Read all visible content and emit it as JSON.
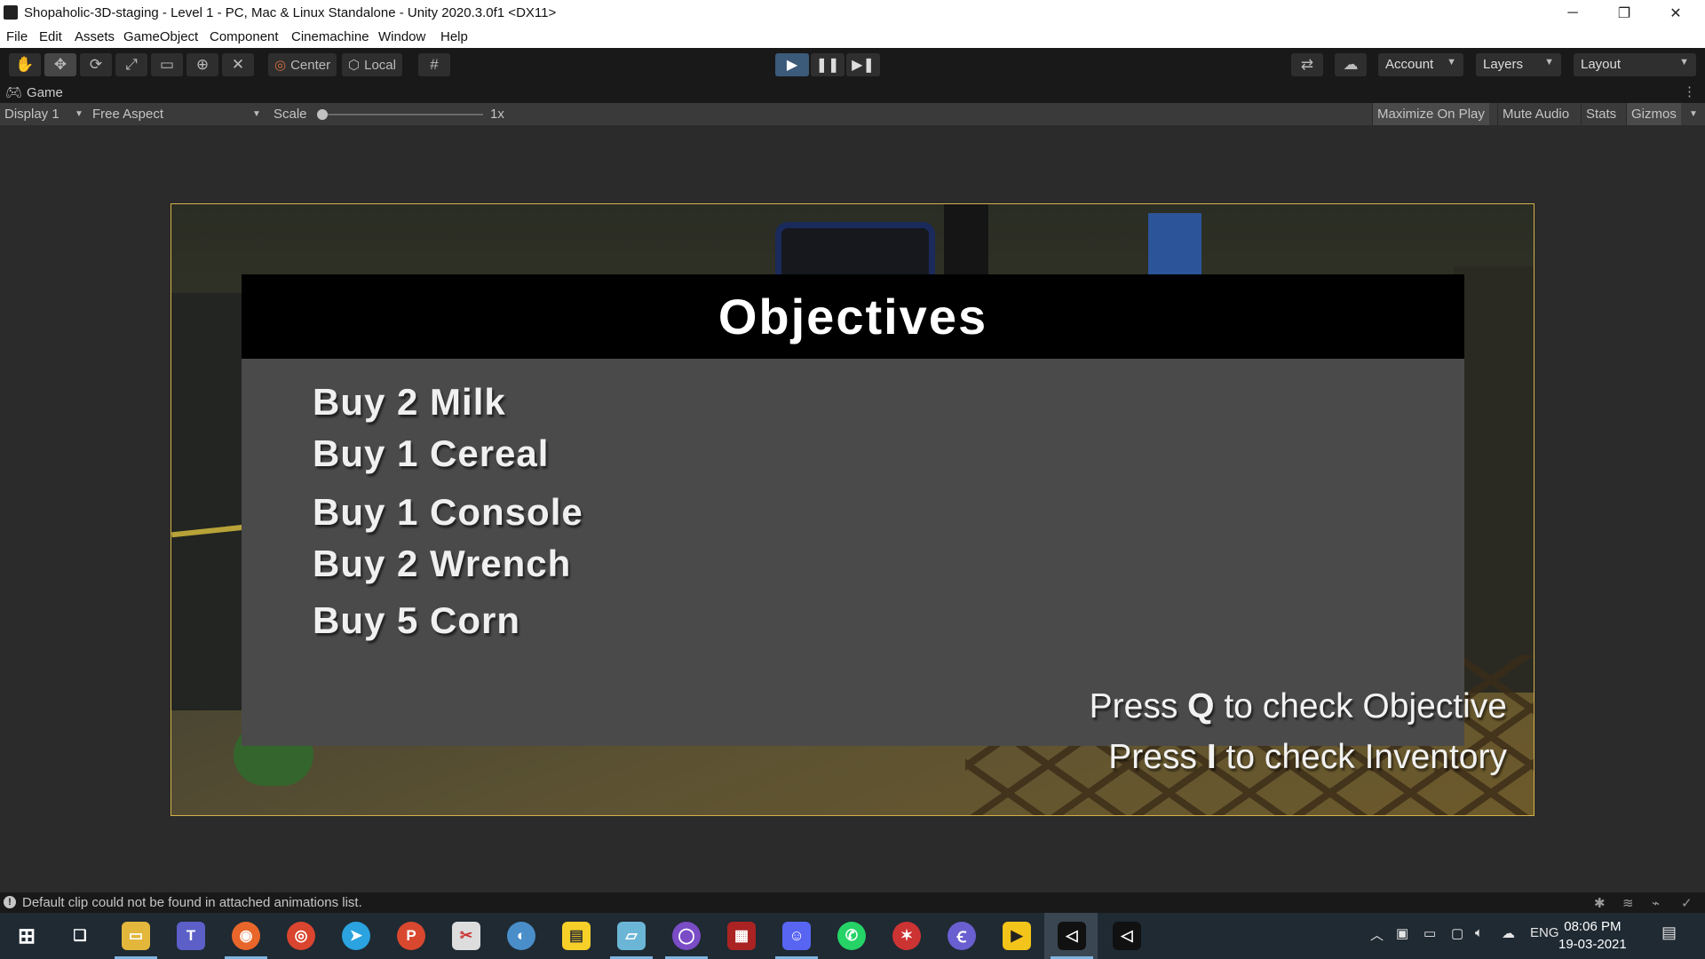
{
  "window": {
    "title": "Shopaholic-3D-staging - Level 1 - PC, Mac & Linux Standalone - Unity 2020.3.0f1 <DX11>",
    "minimize": "─",
    "restore": "❐",
    "close": "✕"
  },
  "menu": [
    "File",
    "Edit",
    "Assets",
    "GameObject",
    "Component",
    "Cinemachine",
    "Window",
    "Help"
  ],
  "toolbar": {
    "tools": [
      "hand-tool-icon",
      "move-tool-icon",
      "rotate-tool-icon",
      "scale-tool-icon",
      "rect-tool-icon",
      "transform-tool-icon",
      "custom-tool-icon"
    ],
    "pivot": "Center",
    "space": "Local",
    "account": "Account",
    "layers": "Layers",
    "layout": "Layout"
  },
  "game_tab": {
    "label": "Game"
  },
  "game_toolbar": {
    "display": "Display 1",
    "aspect": "Free Aspect",
    "scale_label": "Scale",
    "scale_value": "1x",
    "maximize_on_play": "Maximize On Play",
    "mute_audio": "Mute Audio",
    "stats": "Stats",
    "gizmos": "Gizmos"
  },
  "objectives": {
    "title": "Objectives",
    "items": [
      "Buy 2 Milk",
      "Buy 1 Cereal",
      "Buy 1 Console",
      "Buy 2 Wrench",
      "Buy 5 Corn"
    ],
    "hint_q": {
      "pre": "Press ",
      "key": "Q",
      "post": " to check Objective"
    },
    "hint_i": {
      "pre": "Press ",
      "key": "I",
      "post": " to check Inventory"
    }
  },
  "status": {
    "message": "Default clip could not be found in attached animations list."
  },
  "taskbar": {
    "tray_lang": "ENG",
    "time": "08:06 PM",
    "date": "19-03-2021"
  },
  "colors": {
    "editor_bg": "#2b2b2b",
    "toolbar_bg": "#191919",
    "panel_gray": "#4a4a4a",
    "header_black": "#000000",
    "play_active": "#3c5a7a",
    "viewport_border": "#d4b14a"
  }
}
